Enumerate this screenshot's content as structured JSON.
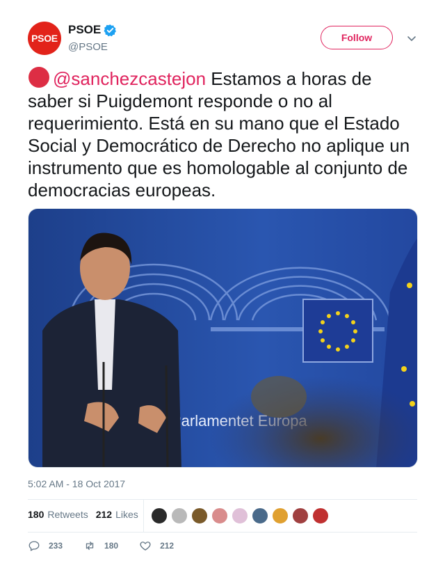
{
  "author": {
    "display_name": "PSOE",
    "handle": "@PSOE",
    "avatar_text": "PSOE",
    "verified": true
  },
  "follow_label": "Follow",
  "tweet": {
    "mention": "@sanchezcastejon",
    "body": " Estamos a horas de saber si Puigdemont responde o no al requerimiento. Está en su mano que el Estado Social y Democrático de Derecho no aplique un instrumento que es homologable al conjunto de democracias europeas.",
    "media_caption_text": "Parlamentet Europa"
  },
  "timestamp": "5:02 AM - 18 Oct 2017",
  "stats": {
    "retweets_count": "180",
    "retweets_label": "Retweets",
    "likes_count": "212",
    "likes_label": "Likes"
  },
  "likers": [
    {
      "name": "liker-1",
      "color": "#2a2a2a"
    },
    {
      "name": "liker-2",
      "color": "#b9b9b9"
    },
    {
      "name": "liker-3",
      "color": "#7a5a2a"
    },
    {
      "name": "liker-4",
      "color": "#d98c8c"
    },
    {
      "name": "liker-5",
      "color": "#e0c0d8"
    },
    {
      "name": "liker-6",
      "color": "#4a6a8a"
    },
    {
      "name": "liker-7",
      "color": "#e0a030"
    },
    {
      "name": "liker-8",
      "color": "#a04040"
    },
    {
      "name": "liker-9",
      "color": "#c03030"
    }
  ],
  "actions": {
    "reply_count": "233",
    "retweet_count": "180",
    "like_count": "212"
  },
  "colors": {
    "accent": "#e0245e",
    "brand": "#e2231a",
    "verified": "#1da1f2",
    "muted": "#657786"
  }
}
